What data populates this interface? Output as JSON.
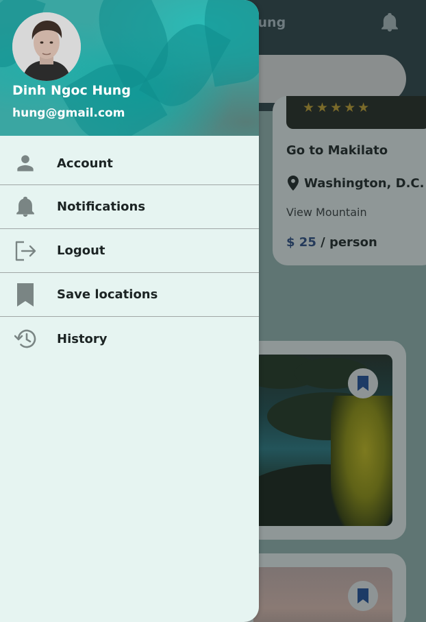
{
  "background": {
    "greeting_fragment": "lung",
    "card1": {
      "title": "Go to Makilato",
      "location": "Washington, D.C. -",
      "category": "View Mountain",
      "price_amount": "$ 25",
      "price_unit": " / person"
    }
  },
  "drawer": {
    "user_name": "Dinh Ngoc Hung",
    "user_email": "hung@gmail.com",
    "menu": [
      {
        "label": "Account",
        "icon": "person-icon"
      },
      {
        "label": "Notifications",
        "icon": "bell-icon"
      },
      {
        "label": "Logout",
        "icon": "logout-icon"
      },
      {
        "label": "Save locations",
        "icon": "bookmark-icon"
      },
      {
        "label": "History",
        "icon": "history-icon"
      }
    ]
  },
  "colors": {
    "drawer_bg": "#e6f4f1",
    "header_teal": "#3aa6a2",
    "icon_gray": "#7a8584",
    "text_dark": "#1c2424",
    "bookmark_blue": "#1d3b66"
  }
}
